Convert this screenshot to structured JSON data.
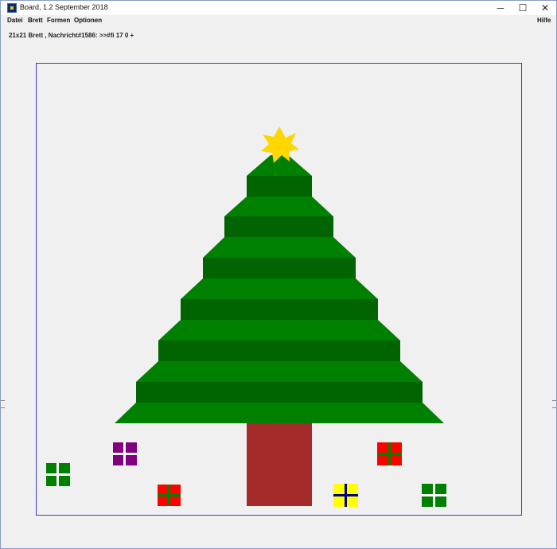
{
  "window": {
    "title": "Board, 1.2 September 2018",
    "controls": {
      "minimize": "─",
      "maximize": "☐",
      "close": "✕"
    }
  },
  "menu": {
    "items": [
      "Datei",
      "Brett",
      "Formen",
      "Optionen"
    ],
    "help": "Hilfe"
  },
  "status_text": "21x21 Brett , Nachricht#1586: >>#fi 17 0 +",
  "board": {
    "grid": "21x21",
    "shapes": {
      "tree_light_green": "#008000",
      "tree_dark_green": "#006400",
      "trunk": "#a52a2a",
      "star": "#ffd700"
    },
    "gifts": [
      {
        "name": "gift-purple",
        "box": "#800080",
        "ribbon": "#ffffff"
      },
      {
        "name": "gift-green-left",
        "box": "#008000",
        "ribbon": "#ffffff"
      },
      {
        "name": "gift-red-left",
        "box": "#ff0000",
        "ribbon": "#008000"
      },
      {
        "name": "gift-red-right",
        "box": "#ff0000",
        "ribbon": "#008000"
      },
      {
        "name": "gift-yellow",
        "box": "#ffff00",
        "ribbon": "#00008b"
      },
      {
        "name": "gift-green-right",
        "box": "#008000",
        "ribbon": "#ffffff"
      }
    ]
  }
}
